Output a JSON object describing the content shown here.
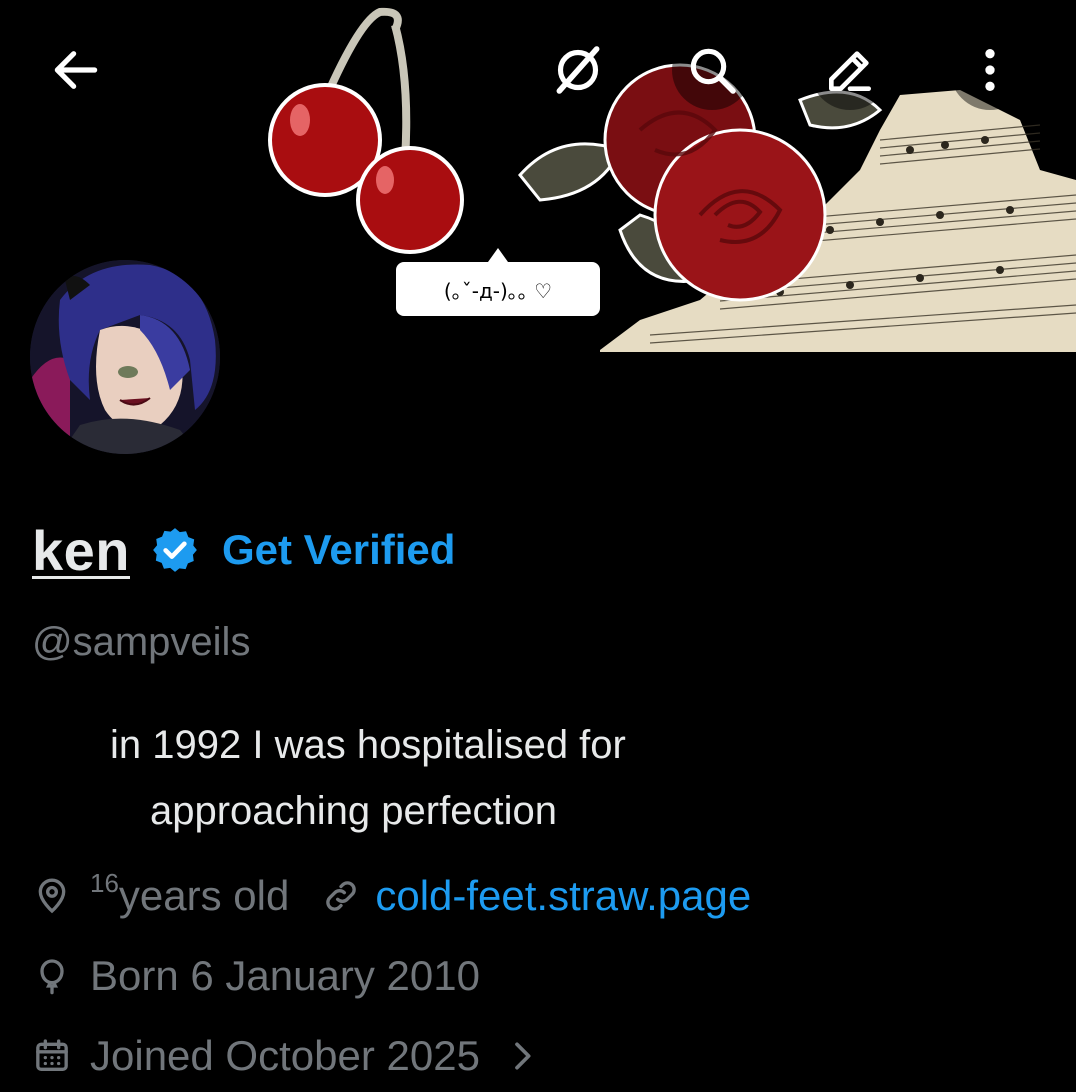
{
  "header": {
    "sticker_text": "(｡ˇ-д-)｡｡ ♡"
  },
  "icons": {
    "back": "arrow-left-icon",
    "grok": "grok-icon",
    "search": "search-icon",
    "edit": "edit-icon",
    "more": "more-vertical-icon"
  },
  "profile": {
    "name": "ken",
    "get_verified_label": "Get Verified",
    "handle": "@sampveils",
    "bio_line1": "in 1992 I was hospitalised for",
    "bio_line2": "approaching perfection",
    "location_sup": "16",
    "location_text": "years old",
    "website": "cold-feet.straw.page",
    "born": "Born 6 January 2010",
    "joined": "Joined October 2025"
  },
  "colors": {
    "background": "#000000",
    "accent": "#1d9bf0",
    "secondary_text": "#71767b",
    "primary_text": "#e7e9ea"
  }
}
